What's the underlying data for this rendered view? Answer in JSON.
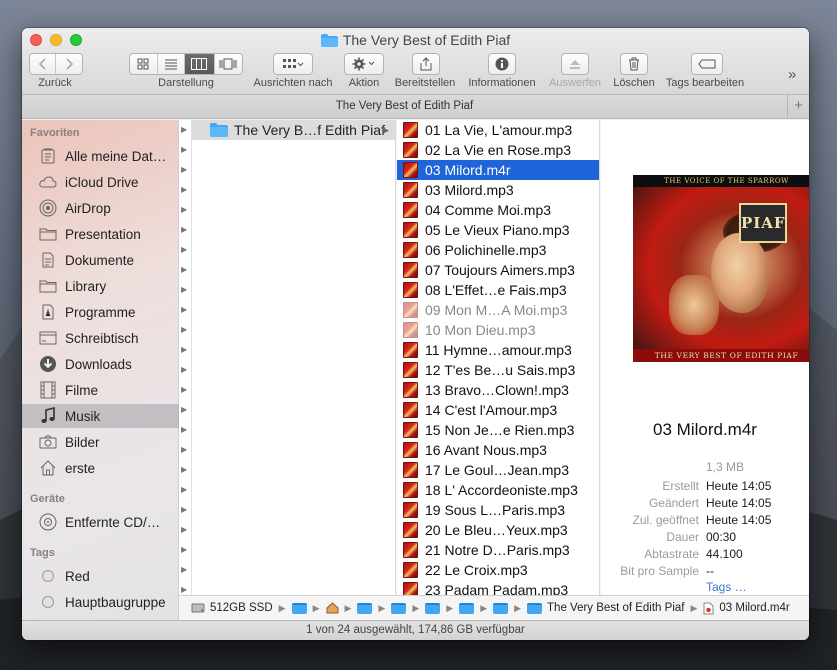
{
  "window": {
    "title": "The Very Best of Edith Piaf"
  },
  "toolbar": {
    "back_label": "Zurück",
    "view_label": "Darstellung",
    "arrange_label": "Ausrichten nach",
    "action_label": "Aktion",
    "share_label": "Bereitstellen",
    "info_label": "Informationen",
    "eject_label": "Auswerfen",
    "delete_label": "Löschen",
    "tags_label": "Tags bearbeiten",
    "more_label": "»"
  },
  "tabbar": {
    "title": "The Very Best of Edith Piaf",
    "add_label": "+"
  },
  "sidebar": {
    "favorites_header": "Favoriten",
    "favorites": [
      {
        "label": "Alle meine Dat…",
        "icon": "all-files-icon"
      },
      {
        "label": "iCloud Drive",
        "icon": "cloud-icon"
      },
      {
        "label": "AirDrop",
        "icon": "airdrop-icon"
      },
      {
        "label": "Presentation",
        "icon": "folder-icon"
      },
      {
        "label": "Dokumente",
        "icon": "document-icon"
      },
      {
        "label": "Library",
        "icon": "folder-icon"
      },
      {
        "label": "Programme",
        "icon": "applications-icon"
      },
      {
        "label": "Schreibtisch",
        "icon": "desktop-icon"
      },
      {
        "label": "Downloads",
        "icon": "download-icon"
      },
      {
        "label": "Filme",
        "icon": "film-icon"
      },
      {
        "label": "Musik",
        "icon": "music-icon"
      },
      {
        "label": "Bilder",
        "icon": "camera-icon"
      },
      {
        "label": "erste",
        "icon": "home-icon"
      }
    ],
    "devices_header": "Geräte",
    "devices": [
      {
        "label": "Entfernte CD/…",
        "icon": "disc-icon"
      }
    ],
    "tags_header": "Tags",
    "tags": [
      {
        "label": "Red",
        "color": "#e0e0e0"
      },
      {
        "label": "Hauptbaugruppe",
        "color": "#e0e0e0"
      }
    ]
  },
  "column2": {
    "folder_label": "The Very B…f Edith Piaf"
  },
  "files": [
    "01 La Vie, L'amour.mp3",
    "02 La Vie en Rose.mp3",
    "03 Milord.m4r",
    "03 Milord.mp3",
    "04 Comme Moi.mp3",
    "05 Le Vieux Piano.mp3",
    "06 Polichinelle.mp3",
    "07 Toujours Aimers.mp3",
    "08 L'Effet…e Fais.mp3",
    "09 Mon M…A Moi.mp3",
    "10 Mon Dieu.mp3",
    "11 Hymne…amour.mp3",
    "12 T'es Be…u Sais.mp3",
    "13 Bravo…Clown!.mp3",
    "14 C'est l'Amour.mp3",
    "15 Non Je…e Rien.mp3",
    "16 Avant Nous.mp3",
    "17 Le Goul…Jean.mp3",
    "18 L' Accordeoniste.mp3",
    "19 Sous L…Paris.mp3",
    "20 Le Bleu…Yeux.mp3",
    "21 Notre D…Paris.mp3",
    "22 Le Croix.mp3",
    "23 Padam Padam.mp3"
  ],
  "preview": {
    "album_top_text": "THE VOICE OF THE SPARROW",
    "album_logo_text": "PIAF",
    "album_bottom_text": "THE VERY BEST OF EDITH PIAF",
    "title": "03 Milord.m4r",
    "size": "1,3 MB",
    "meta": [
      {
        "k": "Erstellt",
        "v": "Heute 14:05"
      },
      {
        "k": "Geändert",
        "v": "Heute 14:05"
      },
      {
        "k": "Zul. geöffnet",
        "v": "Heute 14:05"
      },
      {
        "k": "Dauer",
        "v": "00:30"
      },
      {
        "k": "Abtastrate",
        "v": "44.100"
      },
      {
        "k": "Bit pro Sample",
        "v": "--"
      }
    ],
    "tags_link": "Tags …"
  },
  "pathbar": {
    "disk": "512GB SSD",
    "folder": "The Very Best of Edith Piaf",
    "file": "03 Milord.m4r"
  },
  "status": {
    "text": "1 von 24 ausgewählt, 174,86 GB verfügbar"
  },
  "colors": {
    "selection": "#1f64d8",
    "folder_blue": "#41a6f3"
  }
}
